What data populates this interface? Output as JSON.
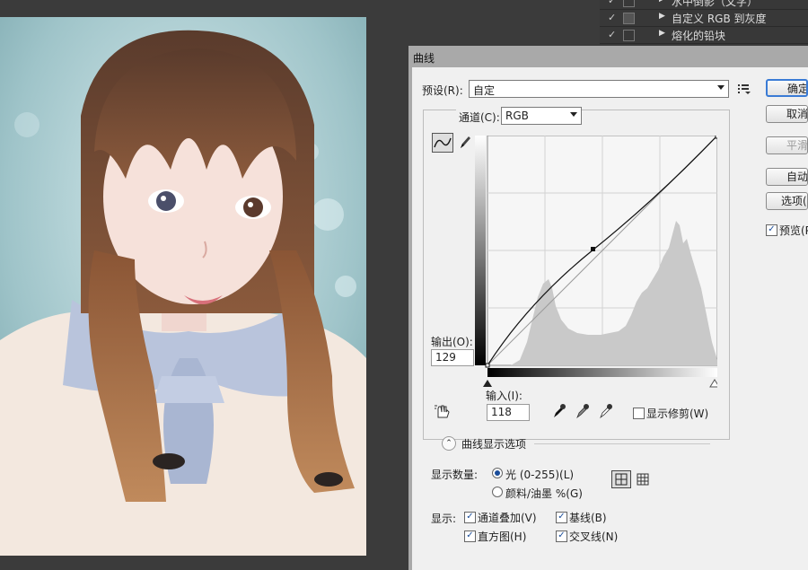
{
  "actions": {
    "items": [
      {
        "label": "水中倒影（文字）"
      },
      {
        "label": "自定义 RGB 到灰度"
      },
      {
        "label": "熔化的铅块"
      }
    ]
  },
  "dialog": {
    "title": "曲线",
    "preset_label": "预设(R):",
    "preset_value": "自定",
    "channel_label": "通道(C):",
    "channel_value": "RGB",
    "output_label": "输出(O):",
    "output_value": "129",
    "input_label": "输入(I):",
    "input_value": "118",
    "show_clipping": "显示修剪(W)",
    "display_options": "曲线显示选项",
    "show_amount_label": "显示数量:",
    "amount_light": "光 (0-255)(L)",
    "amount_pigment": "颜料/油墨 %(G)",
    "show_label": "显示:",
    "chk_channel_overlay": "通道叠加(V)",
    "chk_baseline": "基线(B)",
    "chk_histogram": "直方图(H)",
    "chk_intersection": "交叉线(N)",
    "buttons": {
      "ok": "确定",
      "cancel": "取消",
      "smooth": "平滑",
      "auto": "自动",
      "options": "选项(",
      "preview": "预览(P"
    }
  },
  "colors": {
    "dialog_bg": "#f0f0f0",
    "accent": "#3a7bd5",
    "workspace": "#3b3b3b"
  }
}
